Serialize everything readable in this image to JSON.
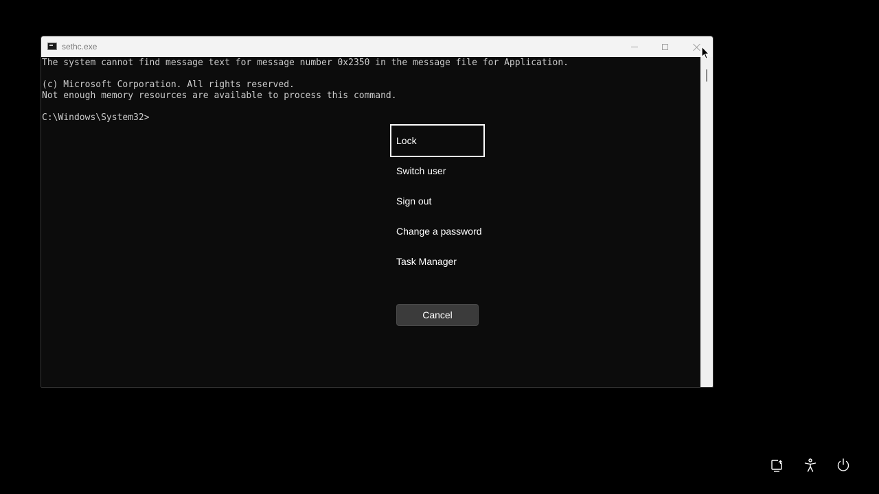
{
  "window": {
    "title": "sethc.exe",
    "icon": "console-app-icon",
    "controls": {
      "minimize": "minimize-icon",
      "maximize": "maximize-icon",
      "close": "close-icon"
    }
  },
  "console": {
    "lines": [
      "The system cannot find message text for message number 0x2350 in the message file for Application.",
      "",
      "(c) Microsoft Corporation. All rights reserved.",
      "Not enough memory resources are available to process this command.",
      "",
      "C:\\Windows\\System32>"
    ],
    "text_color": "#cccccc",
    "background_color": "#0c0c0c"
  },
  "menu": {
    "items": [
      {
        "label": "Lock",
        "focused": true
      },
      {
        "label": "Switch user",
        "focused": false
      },
      {
        "label": "Sign out",
        "focused": false
      },
      {
        "label": "Change a password",
        "focused": false
      },
      {
        "label": "Task Manager",
        "focused": false
      }
    ],
    "cancel_label": "Cancel"
  },
  "system_icons": [
    {
      "name": "network-icon"
    },
    {
      "name": "accessibility-icon"
    },
    {
      "name": "power-icon"
    }
  ]
}
